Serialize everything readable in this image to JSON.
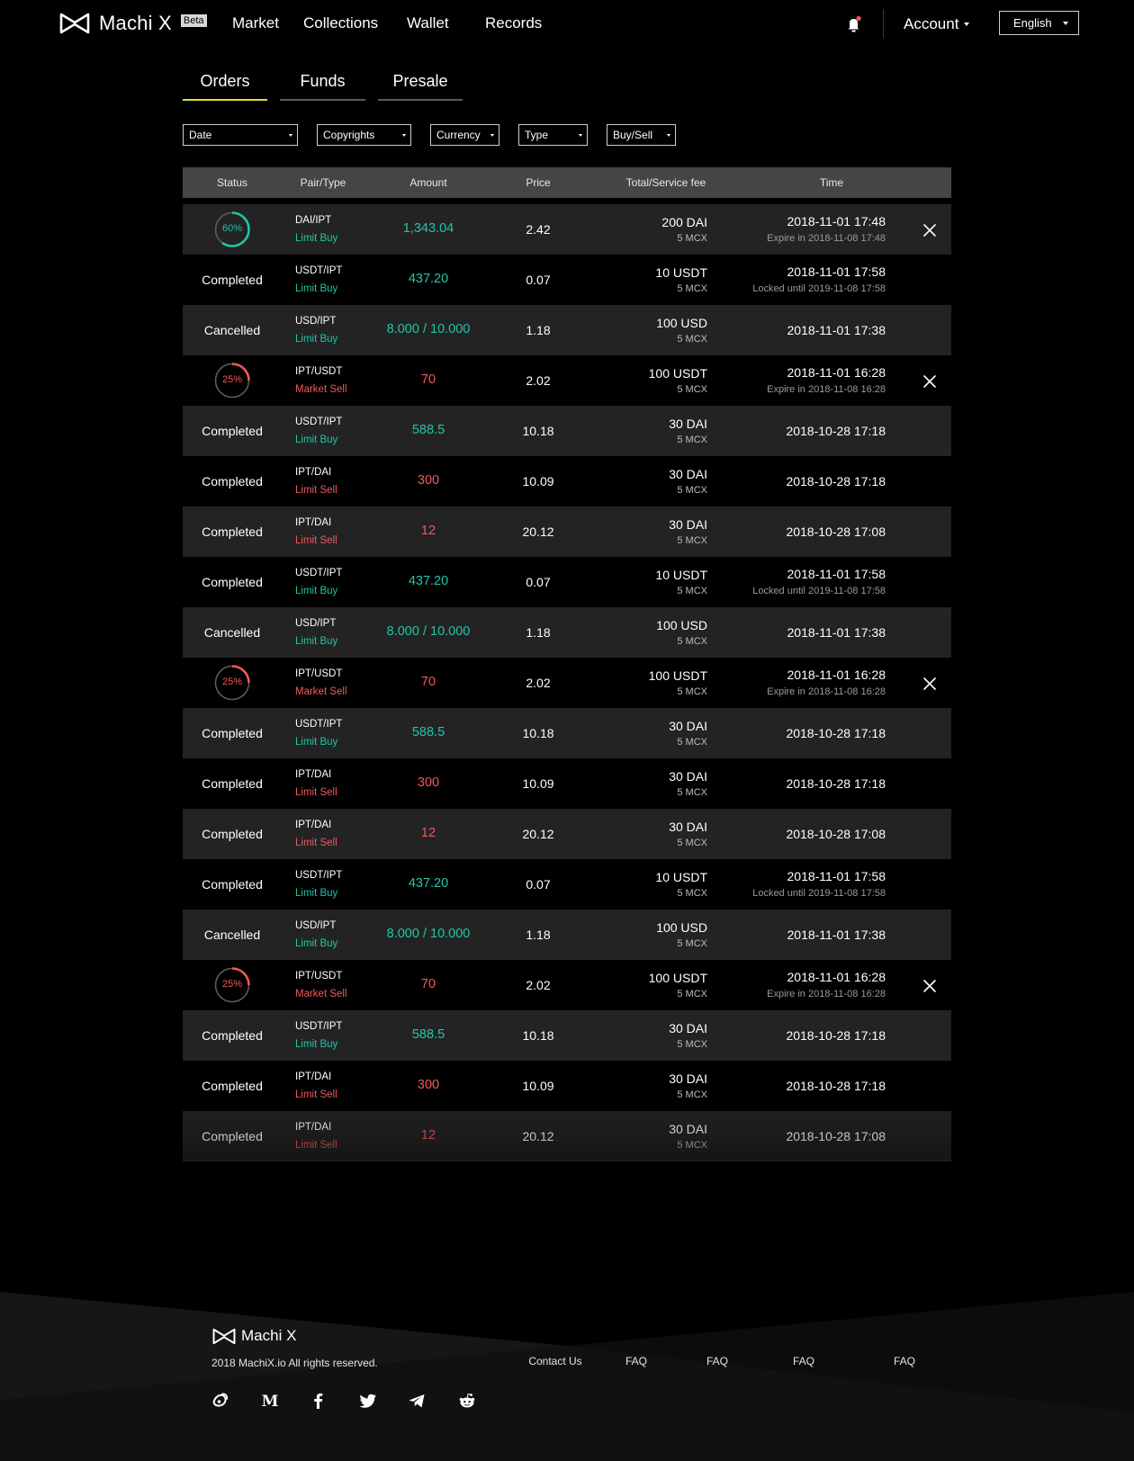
{
  "header": {
    "brand": "Machi X",
    "beta": "Beta",
    "nav": [
      "Market",
      "Collections",
      "Wallet",
      "Records"
    ],
    "account": "Account",
    "language": "English"
  },
  "tabs": [
    {
      "label": "Orders",
      "active": true
    },
    {
      "label": "Funds",
      "active": false
    },
    {
      "label": "Presale",
      "active": false
    }
  ],
  "filters": [
    "Date",
    "Copyrights",
    "Currency",
    "Type",
    "Buy/Sell"
  ],
  "table": {
    "columns": [
      "Status",
      "Pair/Type",
      "Amount",
      "Price",
      "Total/Service fee",
      "Time"
    ],
    "rows": [
      {
        "status": "60%",
        "progress": 0.6,
        "pair": "DAI/IPT",
        "type": "Limit Buy",
        "side": "buy",
        "amount": "1,343.04",
        "price": "2.42",
        "total": "200 DAI",
        "fee": "5 MCX",
        "time": "2018-11-01 17:48",
        "note": "Expire in 2018-11-08 17:48",
        "cancelable": true
      },
      {
        "status": "Completed",
        "pair": "USDT/IPT",
        "type": "Limit Buy",
        "side": "buy",
        "amount": "437.20",
        "price": "0.07",
        "total": "10 USDT",
        "fee": "5 MCX",
        "time": "2018-11-01 17:58",
        "note": "Locked until 2019-11-08 17:58"
      },
      {
        "status": "Cancelled",
        "pair": "USD/IPT",
        "type": "Limit Buy",
        "side": "buy",
        "amount": "8.000 / 10.000",
        "price": "1.18",
        "total": "100 USD",
        "fee": "5 MCX",
        "time": "2018-11-01 17:38"
      },
      {
        "status": "25%",
        "progress": 0.25,
        "pair": "IPT/USDT",
        "type": "Market Sell",
        "side": "sell",
        "amount": "70",
        "price": "2.02",
        "total": "100 USDT",
        "fee": "5 MCX",
        "time": "2018-11-01 16:28",
        "note": "Expire in 2018-11-08 16:28",
        "cancelable": true
      },
      {
        "status": "Completed",
        "pair": "USDT/IPT",
        "type": "Limit Buy",
        "side": "buy",
        "amount": "588.5",
        "price": "10.18",
        "total": "30 DAI",
        "fee": "5 MCX",
        "time": "2018-10-28 17:18"
      },
      {
        "status": "Completed",
        "pair": "IPT/DAI",
        "type": "Limit Sell",
        "side": "sell",
        "amount": "300",
        "price": "10.09",
        "total": "30 DAI",
        "fee": "5 MCX",
        "time": "2018-10-28 17:18"
      },
      {
        "status": "Completed",
        "pair": "IPT/DAI",
        "type": "Limit Sell",
        "side": "sell",
        "amount": "12",
        "price": "20.12",
        "total": "30 DAI",
        "fee": "5 MCX",
        "time": "2018-10-28 17:08"
      },
      {
        "status": "Completed",
        "pair": "USDT/IPT",
        "type": "Limit Buy",
        "side": "buy",
        "amount": "437.20",
        "price": "0.07",
        "total": "10 USDT",
        "fee": "5 MCX",
        "time": "2018-11-01 17:58",
        "note": "Locked until 2019-11-08 17:58"
      },
      {
        "status": "Cancelled",
        "pair": "USD/IPT",
        "type": "Limit Buy",
        "side": "buy",
        "amount": "8.000 / 10.000",
        "price": "1.18",
        "total": "100 USD",
        "fee": "5 MCX",
        "time": "2018-11-01 17:38"
      },
      {
        "status": "25%",
        "progress": 0.25,
        "pair": "IPT/USDT",
        "type": "Market Sell",
        "side": "sell",
        "amount": "70",
        "price": "2.02",
        "total": "100 USDT",
        "fee": "5 MCX",
        "time": "2018-11-01 16:28",
        "note": "Expire in 2018-11-08 16:28",
        "cancelable": true
      },
      {
        "status": "Completed",
        "pair": "USDT/IPT",
        "type": "Limit Buy",
        "side": "buy",
        "amount": "588.5",
        "price": "10.18",
        "total": "30 DAI",
        "fee": "5 MCX",
        "time": "2018-10-28 17:18"
      },
      {
        "status": "Completed",
        "pair": "IPT/DAI",
        "type": "Limit Sell",
        "side": "sell",
        "amount": "300",
        "price": "10.09",
        "total": "30 DAI",
        "fee": "5 MCX",
        "time": "2018-10-28 17:18"
      },
      {
        "status": "Completed",
        "pair": "IPT/DAI",
        "type": "Limit Sell",
        "side": "sell",
        "amount": "12",
        "price": "20.12",
        "total": "30 DAI",
        "fee": "5 MCX",
        "time": "2018-10-28 17:08"
      },
      {
        "status": "Completed",
        "pair": "USDT/IPT",
        "type": "Limit Buy",
        "side": "buy",
        "amount": "437.20",
        "price": "0.07",
        "total": "10 USDT",
        "fee": "5 MCX",
        "time": "2018-11-01 17:58",
        "note": "Locked until 2019-11-08 17:58"
      },
      {
        "status": "Cancelled",
        "pair": "USD/IPT",
        "type": "Limit Buy",
        "side": "buy",
        "amount": "8.000 / 10.000",
        "price": "1.18",
        "total": "100 USD",
        "fee": "5 MCX",
        "time": "2018-11-01 17:38"
      },
      {
        "status": "25%",
        "progress": 0.25,
        "pair": "IPT/USDT",
        "type": "Market Sell",
        "side": "sell",
        "amount": "70",
        "price": "2.02",
        "total": "100 USDT",
        "fee": "5 MCX",
        "time": "2018-11-01 16:28",
        "note": "Expire in 2018-11-08 16:28",
        "cancelable": true
      },
      {
        "status": "Completed",
        "pair": "USDT/IPT",
        "type": "Limit Buy",
        "side": "buy",
        "amount": "588.5",
        "price": "10.18",
        "total": "30 DAI",
        "fee": "5 MCX",
        "time": "2018-10-28 17:18"
      },
      {
        "status": "Completed",
        "pair": "IPT/DAI",
        "type": "Limit Sell",
        "side": "sell",
        "amount": "300",
        "price": "10.09",
        "total": "30 DAI",
        "fee": "5 MCX",
        "time": "2018-10-28 17:18"
      },
      {
        "status": "Completed",
        "pair": "IPT/DAI",
        "type": "Limit Sell",
        "side": "sell",
        "amount": "12",
        "price": "20.12",
        "total": "30 DAI",
        "fee": "5 MCX",
        "time": "2018-10-28 17:08"
      }
    ]
  },
  "footer": {
    "brand": "Machi X",
    "copyright": "2018 MachiX.io All rights reserved.",
    "links": [
      "Contact Us",
      "FAQ",
      "FAQ",
      "FAQ",
      "FAQ"
    ],
    "social_icons": [
      "weibo-icon",
      "medium-icon",
      "facebook-icon",
      "twitter-icon",
      "telegram-icon",
      "reddit-icon"
    ]
  },
  "colors": {
    "accent": "#e9d93a",
    "buy": "#1fc7a6",
    "sell": "#f2585b",
    "notification": "#f2585b"
  }
}
